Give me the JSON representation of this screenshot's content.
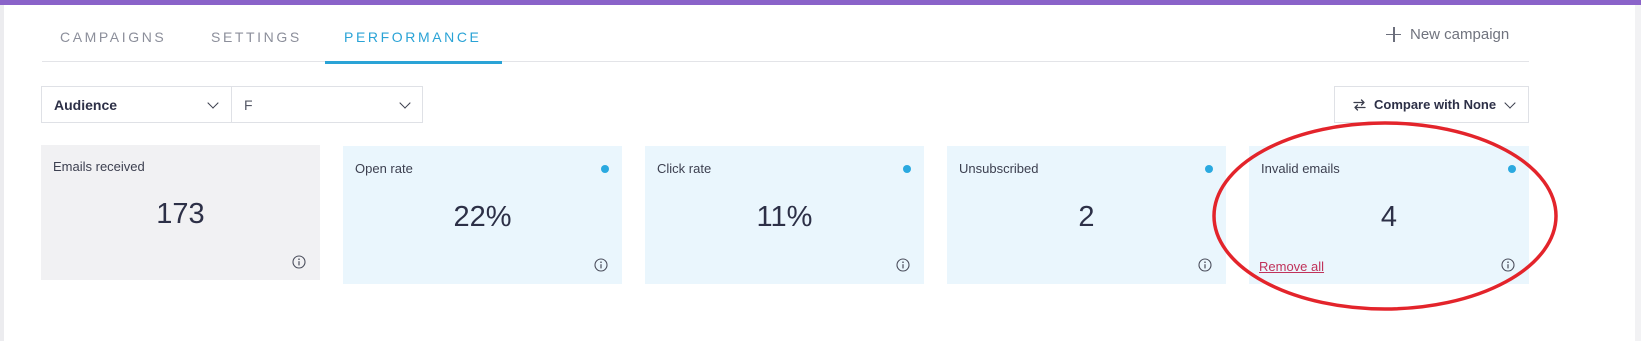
{
  "tabs": [
    {
      "label": "CAMPAIGNS"
    },
    {
      "label": "SETTINGS"
    },
    {
      "label": "PERFORMANCE",
      "active": true
    }
  ],
  "actions": {
    "new_campaign": "New campaign"
  },
  "filters": {
    "audience": "Audience",
    "segment": "F",
    "compare": "Compare with None"
  },
  "cards": [
    {
      "label": "Emails received",
      "value": "173"
    },
    {
      "label": "Open rate",
      "value": "22%"
    },
    {
      "label": "Click rate",
      "value": "11%"
    },
    {
      "label": "Unsubscribed",
      "value": "2"
    },
    {
      "label": "Invalid emails",
      "value": "4",
      "action": "Remove all"
    }
  ],
  "colors": {
    "accent": "#2aa3d6",
    "top_bar": "#8a63c9",
    "card_bg": "#eaf6fd",
    "annotation": "#e3242b",
    "link": "#c0325a"
  },
  "icons": {
    "plus": "plus-icon",
    "chevron": "chevron-down-icon",
    "compare": "swap-arrows-icon",
    "info": "info-icon",
    "status": "status-dot"
  }
}
